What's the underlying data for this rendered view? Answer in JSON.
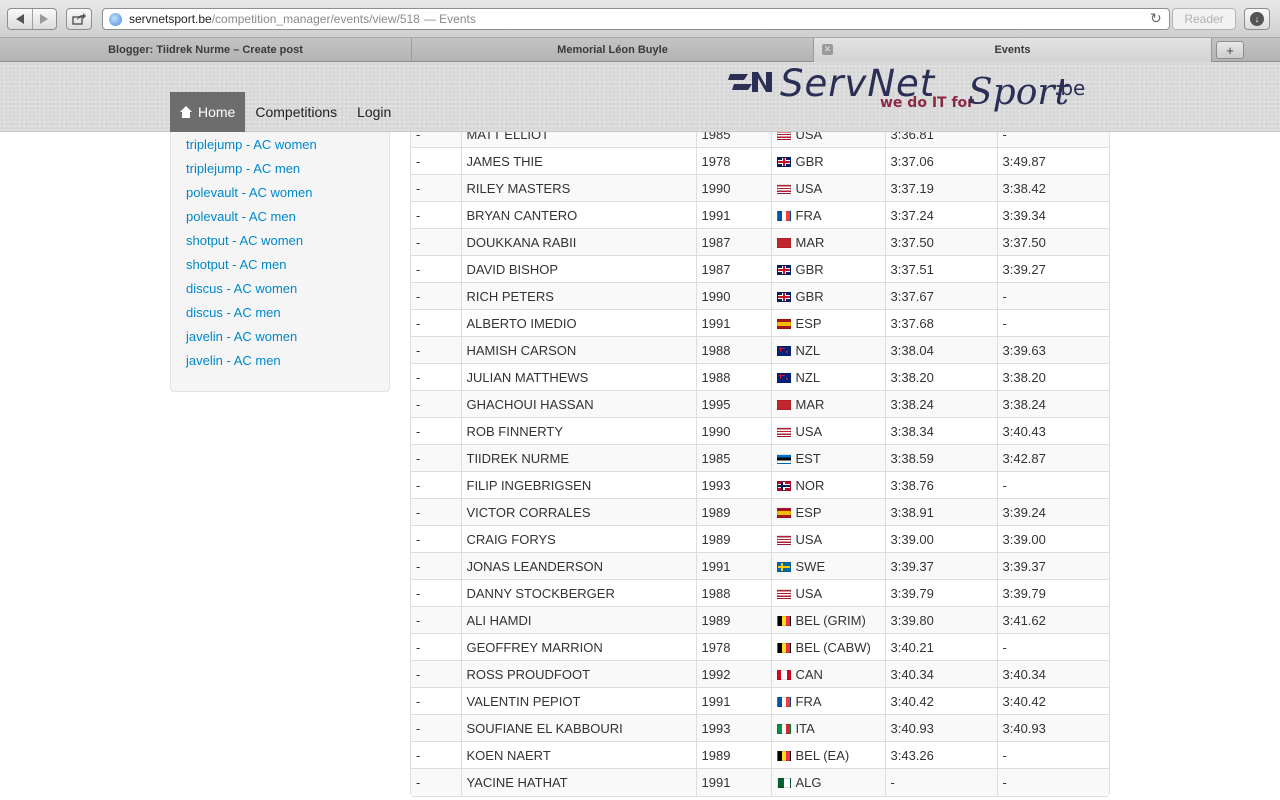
{
  "browser": {
    "url_host": "servnetsport.be",
    "url_path": "/competition_manager/events/view/518",
    "url_title_suffix": "— Events",
    "reader_label": "Reader",
    "tabs": [
      {
        "label": "Blogger: Tiidrek Nurme – Create post",
        "active": false
      },
      {
        "label": "Memorial Léon Buyle",
        "active": false
      },
      {
        "label": "Events",
        "active": true
      }
    ],
    "new_tab_label": "+"
  },
  "site": {
    "logo": {
      "main": "ServNet",
      "tagline": "we do IT for",
      "sport": "Sport",
      "tld": ".be",
      "colors": {
        "navy": "#2b2f56",
        "burgundy": "#8b2a45"
      }
    },
    "nav": [
      {
        "label": "Home",
        "icon": "home-icon",
        "active": true
      },
      {
        "label": "Competitions",
        "active": false
      },
      {
        "label": "Login",
        "active": false
      }
    ]
  },
  "sidebar": {
    "links": [
      "triplejump - AC women",
      "triplejump - AC men",
      "polevault - AC women",
      "polevault - AC men",
      "shotput - AC women",
      "shotput - AC men",
      "discus - AC women",
      "discus - AC men",
      "javelin - AC women",
      "javelin - AC men"
    ],
    "link_color": "#0088cc"
  },
  "results": {
    "rows": [
      {
        "rank": "-",
        "name": "MATT ELLIOT",
        "year": "1985",
        "country": "USA",
        "flag": "flag-usa",
        "performance": "3:36.81",
        "best": "-"
      },
      {
        "rank": "-",
        "name": "JAMES THIE",
        "year": "1978",
        "country": "GBR",
        "flag": "flag-gbr",
        "performance": "3:37.06",
        "best": "3:49.87"
      },
      {
        "rank": "-",
        "name": "RILEY MASTERS",
        "year": "1990",
        "country": "USA",
        "flag": "flag-usa",
        "performance": "3:37.19",
        "best": "3:38.42"
      },
      {
        "rank": "-",
        "name": "BRYAN CANTERO",
        "year": "1991",
        "country": "FRA",
        "flag": "flag-fra",
        "performance": "3:37.24",
        "best": "3:39.34"
      },
      {
        "rank": "-",
        "name": "DOUKKANA RABII",
        "year": "1987",
        "country": "MAR",
        "flag": "flag-mar",
        "performance": "3:37.50",
        "best": "3:37.50"
      },
      {
        "rank": "-",
        "name": "DAVID BISHOP",
        "year": "1987",
        "country": "GBR",
        "flag": "flag-gbr",
        "performance": "3:37.51",
        "best": "3:39.27"
      },
      {
        "rank": "-",
        "name": "RICH PETERS",
        "year": "1990",
        "country": "GBR",
        "flag": "flag-gbr",
        "performance": "3:37.67",
        "best": "-"
      },
      {
        "rank": "-",
        "name": "ALBERTO IMEDIO",
        "year": "1991",
        "country": "ESP",
        "flag": "flag-esp",
        "performance": "3:37.68",
        "best": "-"
      },
      {
        "rank": "-",
        "name": "HAMISH CARSON",
        "year": "1988",
        "country": "NZL",
        "flag": "flag-nzl",
        "performance": "3:38.04",
        "best": "3:39.63"
      },
      {
        "rank": "-",
        "name": "JULIAN MATTHEWS",
        "year": "1988",
        "country": "NZL",
        "flag": "flag-nzl",
        "performance": "3:38.20",
        "best": "3:38.20"
      },
      {
        "rank": "-",
        "name": "GHACHOUI HASSAN",
        "year": "1995",
        "country": "MAR",
        "flag": "flag-mar",
        "performance": "3:38.24",
        "best": "3:38.24"
      },
      {
        "rank": "-",
        "name": "ROB FINNERTY",
        "year": "1990",
        "country": "USA",
        "flag": "flag-usa",
        "performance": "3:38.34",
        "best": "3:40.43"
      },
      {
        "rank": "-",
        "name": "TIIDREK NURME",
        "year": "1985",
        "country": "EST",
        "flag": "flag-est",
        "performance": "3:38.59",
        "best": "3:42.87"
      },
      {
        "rank": "-",
        "name": "FILIP INGEBRIGSEN",
        "year": "1993",
        "country": "NOR",
        "flag": "flag-nor",
        "performance": "3:38.76",
        "best": "-"
      },
      {
        "rank": "-",
        "name": "VICTOR CORRALES",
        "year": "1989",
        "country": "ESP",
        "flag": "flag-esp",
        "performance": "3:38.91",
        "best": "3:39.24"
      },
      {
        "rank": "-",
        "name": "CRAIG FORYS",
        "year": "1989",
        "country": "USA",
        "flag": "flag-usa",
        "performance": "3:39.00",
        "best": "3:39.00"
      },
      {
        "rank": "-",
        "name": "JONAS LEANDERSON",
        "year": "1991",
        "country": "SWE",
        "flag": "flag-swe",
        "performance": "3:39.37",
        "best": "3:39.37"
      },
      {
        "rank": "-",
        "name": "DANNY STOCKBERGER",
        "year": "1988",
        "country": "USA",
        "flag": "flag-usa",
        "performance": "3:39.79",
        "best": "3:39.79"
      },
      {
        "rank": "-",
        "name": "ALI HAMDI",
        "year": "1989",
        "country": "BEL (GRIM)",
        "flag": "flag-bel",
        "performance": "3:39.80",
        "best": "3:41.62"
      },
      {
        "rank": "-",
        "name": "GEOFFREY MARRION",
        "year": "1978",
        "country": "BEL (CABW)",
        "flag": "flag-bel",
        "performance": "3:40.21",
        "best": "-"
      },
      {
        "rank": "-",
        "name": "ROSS PROUDFOOT",
        "year": "1992",
        "country": "CAN",
        "flag": "flag-can",
        "performance": "3:40.34",
        "best": "3:40.34"
      },
      {
        "rank": "-",
        "name": "VALENTIN PEPIOT",
        "year": "1991",
        "country": "FRA",
        "flag": "flag-fra",
        "performance": "3:40.42",
        "best": "3:40.42"
      },
      {
        "rank": "-",
        "name": "SOUFIANE EL KABBOURI",
        "year": "1993",
        "country": "ITA",
        "flag": "flag-ita",
        "performance": "3:40.93",
        "best": "3:40.93"
      },
      {
        "rank": "-",
        "name": "KOEN NAERT",
        "year": "1989",
        "country": "BEL (EA)",
        "flag": "flag-bel",
        "performance": "3:43.26",
        "best": "-"
      },
      {
        "rank": "-",
        "name": "YACINE HATHAT",
        "year": "1991",
        "country": "ALG",
        "flag": "flag-alg",
        "performance": "-",
        "best": "-"
      }
    ]
  },
  "flag_styles": {
    "flag-usa": "repeating-linear-gradient(180deg,#b22234 0 1.4px,#ffffff 1.4px 2.8px) , #b22234",
    "flag-gbr": "linear-gradient(#c8102e,#c8102e) center/100% 2px no-repeat, linear-gradient(#c8102e,#c8102e) center/2px 100% no-repeat, linear-gradient(#fff,#fff) center/100% 4px no-repeat, linear-gradient(#fff,#fff) center/4px 100% no-repeat, #012169",
    "flag-fra": "linear-gradient(90deg,#0055a4 0 33%,#ffffff 33% 66%,#ef4135 66%)",
    "flag-mar": "#c1272d",
    "flag-esp": "linear-gradient(180deg,#aa151b 0 25%,#f1bf00 25% 75%,#aa151b 75%)",
    "flag-nzl": "linear-gradient(#cc142b,#cc142b) 25% 25%/6px 1px no-repeat, linear-gradient(#cc142b,#cc142b) 25% 25%/1px 5px no-repeat, radial-gradient(circle at 75% 60%, #cc142b 0 1px, transparent 1.2px), #00247d",
    "flag-est": "linear-gradient(180deg,#0072ce 0 33%,#000000 33% 66%,#ffffff 66%)",
    "flag-nor": "linear-gradient(#00205b,#00205b) 38% 50%/100% 2px no-repeat, linear-gradient(#00205b,#00205b) 38% 50%/2px 100% no-repeat, linear-gradient(#fff,#fff) 38% 50%/100% 4px no-repeat, linear-gradient(#fff,#fff) 38% 50%/4px 100% no-repeat, #ba0c2f",
    "flag-swe": "linear-gradient(#fecc00,#fecc00) 38% 50%/100% 2px no-repeat, linear-gradient(#fecc00,#fecc00) 38% 50%/2px 100% no-repeat, #006aa7",
    "flag-bel": "linear-gradient(90deg,#000000 0 33%,#fdda24 33% 66%,#ef3340 66%)",
    "flag-can": "linear-gradient(90deg,#d80621 0 25%,#ffffff 25% 75%,#d80621 75%)",
    "flag-ita": "linear-gradient(90deg,#009246 0 33%,#ffffff 33% 66%,#ce2b37 66%)",
    "flag-alg": "linear-gradient(90deg,#006233 0 50%,#ffffff 50%)"
  }
}
